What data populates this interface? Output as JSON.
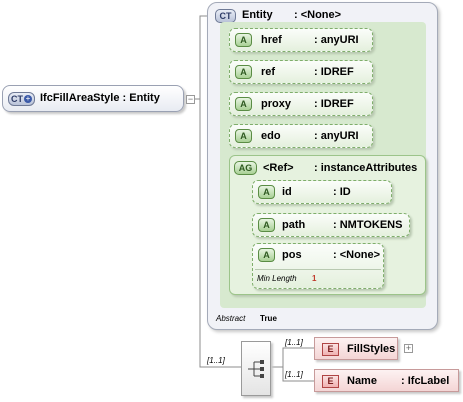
{
  "root": {
    "badge": "CT",
    "label": "IfcFillAreaStyle : Entity",
    "expand_symbol": "−"
  },
  "complex_type": {
    "badge": "CT",
    "name": "Entity",
    "type": ": <None>"
  },
  "attributes": [
    {
      "badge": "A",
      "name": "href",
      "type": ": anyURI"
    },
    {
      "badge": "A",
      "name": "ref",
      "type": ": IDREF"
    },
    {
      "badge": "A",
      "name": "proxy",
      "type": ": IDREF"
    },
    {
      "badge": "A",
      "name": "edo",
      "type": ": anyURI"
    }
  ],
  "attribute_group": {
    "badge": "AG",
    "name": "<Ref>",
    "type": ": instanceAttributes",
    "attributes": [
      {
        "badge": "A",
        "name": "id",
        "type": ": ID"
      },
      {
        "badge": "A",
        "name": "path",
        "type": ": NMTOKENS"
      },
      {
        "badge": "A",
        "name": "pos",
        "type": ": <None>",
        "facet_label": "Min Length",
        "facet_value": "1"
      }
    ]
  },
  "abstract": {
    "label": "Abstract",
    "value": "True"
  },
  "sequence": {
    "cardinality": "[1..1]",
    "elements": [
      {
        "badge": "E",
        "name": "FillStyles",
        "type": "",
        "cardinality": "[1..1]",
        "expand_symbol": "+"
      },
      {
        "badge": "E",
        "name": "Name",
        "type": ": IfcLabel",
        "cardinality": "[1..1]"
      }
    ]
  },
  "colors": {
    "attribute_fill": "#d7e9cf",
    "element_fill": "#f4d5d5",
    "complex_type_fill": "#f1f2f7"
  }
}
